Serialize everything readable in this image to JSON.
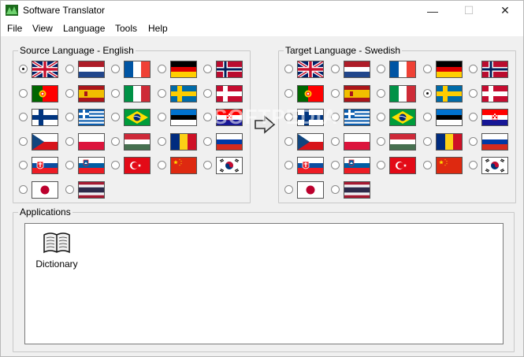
{
  "window": {
    "title": "Software Translator",
    "controls": {
      "minimize": "—",
      "maximize": "☐",
      "close": "✕"
    }
  },
  "menu": [
    "File",
    "View",
    "Language",
    "Tools",
    "Help"
  ],
  "source": {
    "label": "Source Language - English",
    "selected": "uk",
    "flags": [
      "uk",
      "netherlands",
      "france",
      "germany",
      "norway",
      "portugal",
      "spain",
      "italy",
      "sweden",
      "denmark",
      "finland",
      "greece",
      "brazil",
      "estonia",
      "croatia",
      "czech",
      "poland",
      "hungary",
      "romania",
      "russia",
      "slovakia",
      "slovenia",
      "turkey",
      "china",
      "korea",
      "japan",
      "thailand"
    ]
  },
  "target": {
    "label": "Target Language - Swedish",
    "selected": "sweden",
    "flags": [
      "uk",
      "netherlands",
      "france",
      "germany",
      "norway",
      "portugal",
      "spain",
      "italy",
      "sweden",
      "denmark",
      "finland",
      "greece",
      "brazil",
      "estonia",
      "croatia",
      "czech",
      "poland",
      "hungary",
      "romania",
      "russia",
      "slovakia",
      "slovenia",
      "turkey",
      "china",
      "korea",
      "japan",
      "thailand"
    ]
  },
  "arrow_icon": "arrow-right-icon",
  "applications": {
    "label": "Applications",
    "items": [
      {
        "label": "Dictionary",
        "icon": "book-icon"
      }
    ]
  },
  "watermark": "SOFTPEDIA"
}
